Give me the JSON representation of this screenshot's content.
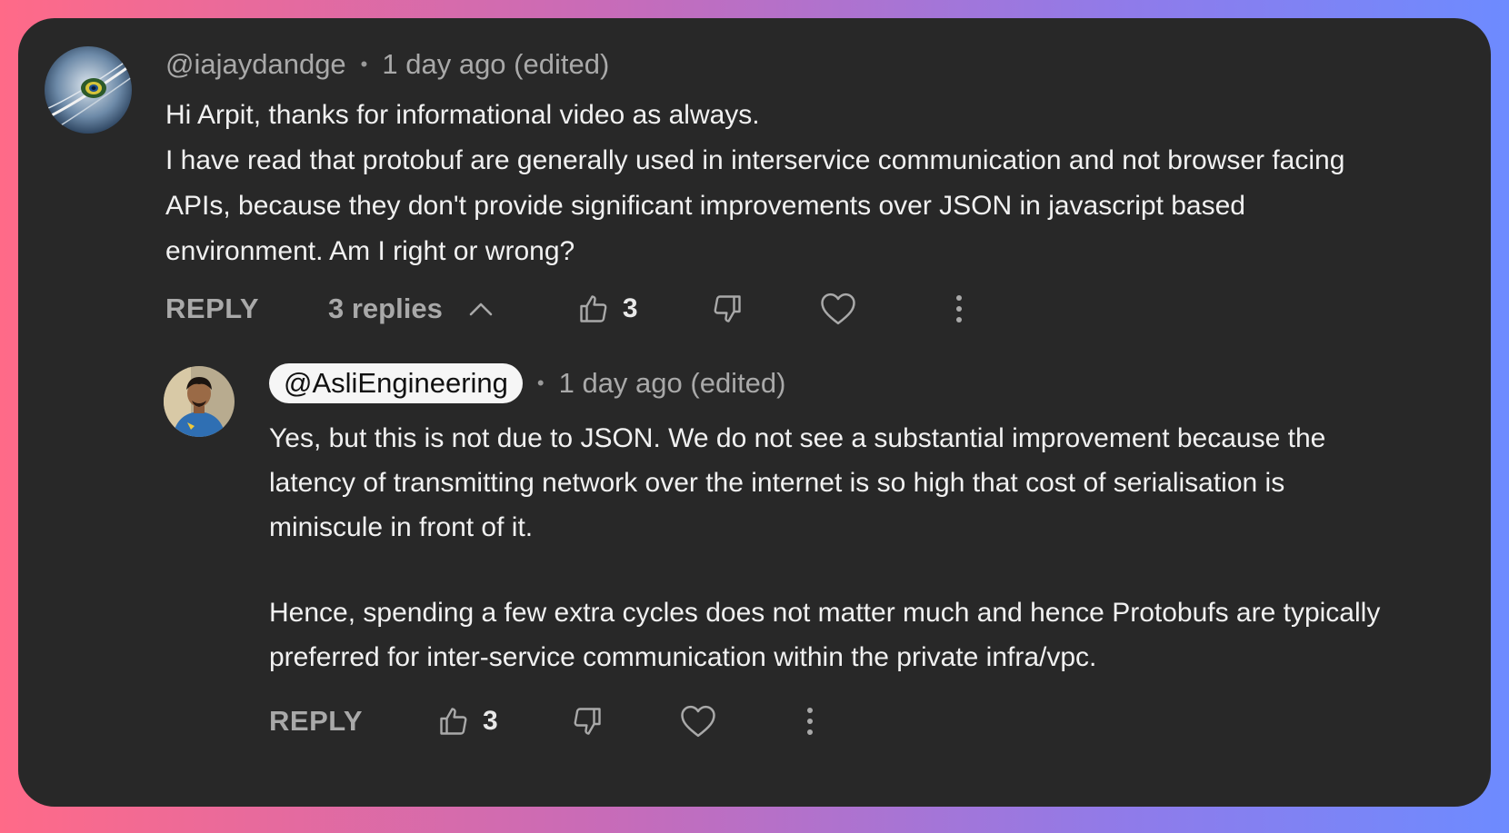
{
  "top_comment": {
    "handle": "@iajaydandge",
    "separator": "•",
    "time": "1 day ago (edited)",
    "lines": [
      "Hi Arpit, thanks for informational video as always.",
      "I have read that protobuf are generally used in interservice communication and not browser facing APIs, because they don't provide significant improvements over JSON in javascript based environment. Am I right or wrong?"
    ],
    "reply_label": "REPLY",
    "replies_label": "3 replies",
    "like_count": "3"
  },
  "reply_comment": {
    "handle": "@AsliEngineering",
    "separator": "•",
    "time": "1 day ago (edited)",
    "paragraphs": [
      "Yes, but this is not due to JSON. We do not see a substantial improvement because the latency of transmitting network over the internet is so high that cost of serialisation is miniscule in front of it.",
      "Hence, spending a few extra cycles does not matter much and hence Protobufs are typically preferred for inter-service communication within the private infra/vpc."
    ],
    "reply_label": "REPLY",
    "like_count": "3"
  },
  "icons": {
    "top_avatar": "peacock-feather-avatar",
    "reply_avatar": "person-avatar",
    "like": "thumbs-up-icon",
    "dislike": "thumbs-down-icon",
    "heart": "heart-icon",
    "more": "more-vertical-icon",
    "chevron": "chevron-up-icon"
  },
  "colors": {
    "card_background": "#282828",
    "text_primary": "#f1f1f1",
    "text_secondary": "#a9a9a9",
    "handle_pill": "#f6f6f6"
  }
}
